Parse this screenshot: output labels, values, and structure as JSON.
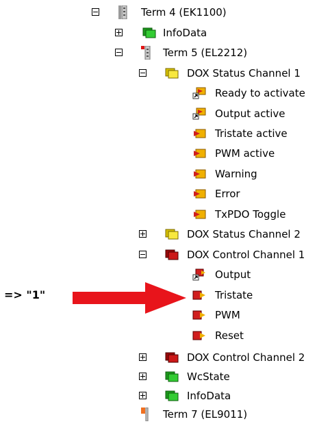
{
  "tree": {
    "nodes": [
      {
        "label": "Term 4 (EK1100)",
        "icon": "terminal-gray-icon",
        "expander": "minus"
      },
      {
        "label": "InfoData",
        "icon": "green-folder-icon",
        "expander": "plus"
      },
      {
        "label": "Term 5 (EL2212)",
        "icon": "terminal-red-icon",
        "expander": "minus"
      },
      {
        "label": "DOX Status Channel 1",
        "icon": "yellow-folder-icon",
        "expander": "minus"
      },
      {
        "label": "Ready to activate",
        "icon": "input-var-link-icon"
      },
      {
        "label": "Output active",
        "icon": "input-var-link-icon"
      },
      {
        "label": "Tristate active",
        "icon": "input-var-icon"
      },
      {
        "label": "PWM active",
        "icon": "input-var-icon"
      },
      {
        "label": "Warning",
        "icon": "input-var-icon"
      },
      {
        "label": "Error",
        "icon": "input-var-icon"
      },
      {
        "label": "TxPDO Toggle",
        "icon": "input-var-icon"
      },
      {
        "label": "DOX Status Channel 2",
        "icon": "yellow-folder-icon",
        "expander": "plus"
      },
      {
        "label": "DOX Control Channel 1",
        "icon": "red-folder-icon",
        "expander": "minus"
      },
      {
        "label": "Output",
        "icon": "output-var-link-icon"
      },
      {
        "label": "Tristate",
        "icon": "output-var-icon"
      },
      {
        "label": "PWM",
        "icon": "output-var-icon"
      },
      {
        "label": "Reset",
        "icon": "output-var-icon"
      },
      {
        "label": "DOX Control Channel 2",
        "icon": "red-folder-icon",
        "expander": "plus"
      },
      {
        "label": "WcState",
        "icon": "green-folder-icon",
        "expander": "plus"
      },
      {
        "label": "InfoData",
        "icon": "green-folder-icon",
        "expander": "plus"
      },
      {
        "label": "Term 7 (EL9011)",
        "icon": "terminal-end-icon"
      }
    ]
  },
  "annotation": {
    "text": "=> \"1\""
  },
  "colors": {
    "arrow": "#e8141b",
    "folder_green": "#29c229",
    "folder_yellow": "#f5e23a",
    "folder_red": "#c81414",
    "var_input": "#f0b000",
    "var_output": "#d01e1e"
  }
}
